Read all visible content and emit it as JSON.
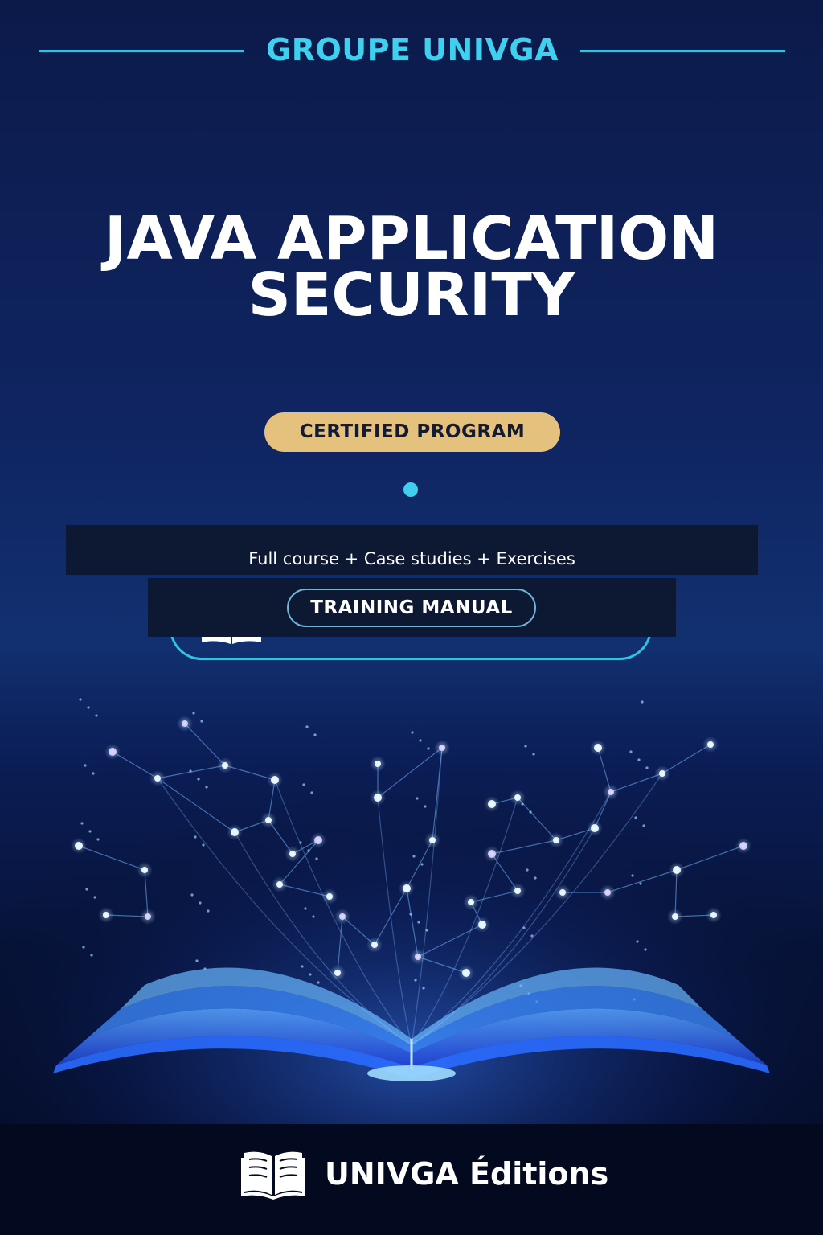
{
  "header": {
    "brand": "GROUPE UNIVGA"
  },
  "cover": {
    "title_line1": "JAVA APPLICATION",
    "title_line2": "SECURITY",
    "badge": "CERTIFIED PROGRAM",
    "subtitle": "Full course + Case studies + Exercises",
    "manual_label": "TRAINING MANUAL"
  },
  "footer": {
    "publisher": "UNIVGA Éditions",
    "logo_icon": "open-book-icon"
  },
  "colors": {
    "accent": "#3fd0ef",
    "badge_gold": "#e5c17e",
    "background_dark": "#0c1a4a",
    "label_box": "#0d1833"
  }
}
